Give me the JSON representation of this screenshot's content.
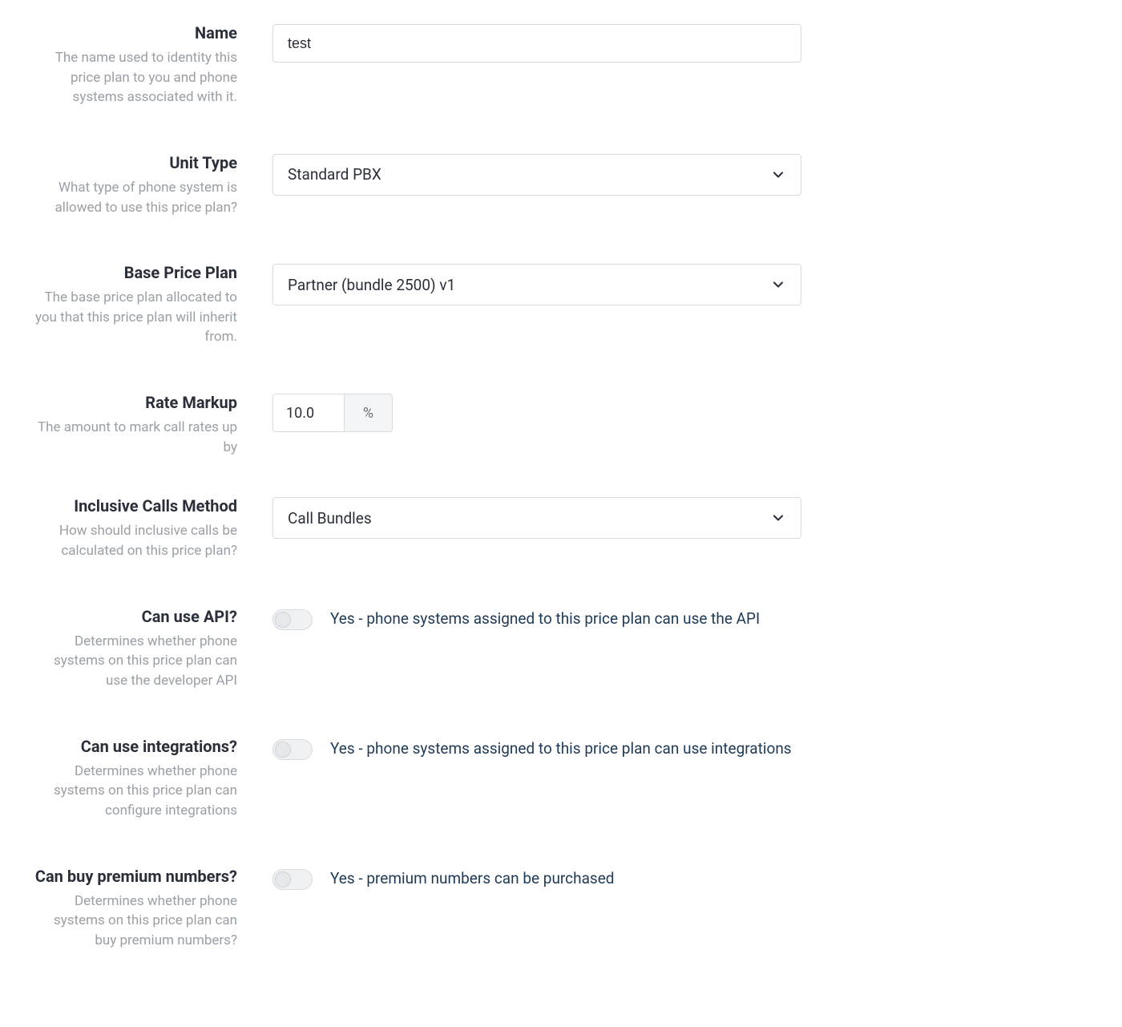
{
  "fields": {
    "name": {
      "label": "Name",
      "help": "The name used to identity this price plan to you and phone systems associated with it.",
      "value": "test"
    },
    "unit_type": {
      "label": "Unit Type",
      "help": "What type of phone system is allowed to use this price plan?",
      "value": "Standard PBX"
    },
    "base_price_plan": {
      "label": "Base Price Plan",
      "help": "The base price plan allocated to you that this price plan will inherit from.",
      "value": "Partner (bundle 2500) v1"
    },
    "rate_markup": {
      "label": "Rate Markup",
      "help": "The amount to mark call rates up by",
      "value": "10.0",
      "unit": "%"
    },
    "inclusive_calls_method": {
      "label": "Inclusive Calls Method",
      "help": "How should inclusive calls be calculated on this price plan?",
      "value": "Call Bundles"
    },
    "can_use_api": {
      "label": "Can use API?",
      "help": "Determines whether phone systems on this price plan can use the developer API",
      "desc": "Yes - phone systems assigned to this price plan can use the API"
    },
    "can_use_integrations": {
      "label": "Can use integrations?",
      "help": "Determines whether phone systems on this price plan can configure integrations",
      "desc": "Yes - phone systems assigned to this price plan can use integrations"
    },
    "can_buy_premium_numbers": {
      "label": "Can buy premium numbers?",
      "help": "Determines whether phone systems on this price plan can buy premium numbers?",
      "desc": "Yes - premium numbers can be purchased"
    }
  }
}
